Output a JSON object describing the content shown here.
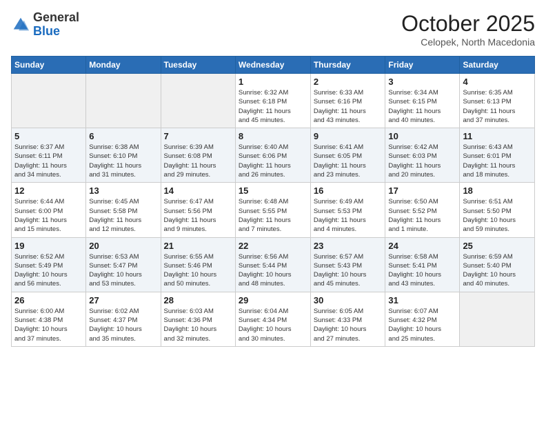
{
  "header": {
    "logo_general": "General",
    "logo_blue": "Blue",
    "month": "October 2025",
    "location": "Celopek, North Macedonia"
  },
  "weekdays": [
    "Sunday",
    "Monday",
    "Tuesday",
    "Wednesday",
    "Thursday",
    "Friday",
    "Saturday"
  ],
  "weeks": [
    [
      {
        "day": "",
        "info": ""
      },
      {
        "day": "",
        "info": ""
      },
      {
        "day": "",
        "info": ""
      },
      {
        "day": "1",
        "info": "Sunrise: 6:32 AM\nSunset: 6:18 PM\nDaylight: 11 hours\nand 45 minutes."
      },
      {
        "day": "2",
        "info": "Sunrise: 6:33 AM\nSunset: 6:16 PM\nDaylight: 11 hours\nand 43 minutes."
      },
      {
        "day": "3",
        "info": "Sunrise: 6:34 AM\nSunset: 6:15 PM\nDaylight: 11 hours\nand 40 minutes."
      },
      {
        "day": "4",
        "info": "Sunrise: 6:35 AM\nSunset: 6:13 PM\nDaylight: 11 hours\nand 37 minutes."
      }
    ],
    [
      {
        "day": "5",
        "info": "Sunrise: 6:37 AM\nSunset: 6:11 PM\nDaylight: 11 hours\nand 34 minutes."
      },
      {
        "day": "6",
        "info": "Sunrise: 6:38 AM\nSunset: 6:10 PM\nDaylight: 11 hours\nand 31 minutes."
      },
      {
        "day": "7",
        "info": "Sunrise: 6:39 AM\nSunset: 6:08 PM\nDaylight: 11 hours\nand 29 minutes."
      },
      {
        "day": "8",
        "info": "Sunrise: 6:40 AM\nSunset: 6:06 PM\nDaylight: 11 hours\nand 26 minutes."
      },
      {
        "day": "9",
        "info": "Sunrise: 6:41 AM\nSunset: 6:05 PM\nDaylight: 11 hours\nand 23 minutes."
      },
      {
        "day": "10",
        "info": "Sunrise: 6:42 AM\nSunset: 6:03 PM\nDaylight: 11 hours\nand 20 minutes."
      },
      {
        "day": "11",
        "info": "Sunrise: 6:43 AM\nSunset: 6:01 PM\nDaylight: 11 hours\nand 18 minutes."
      }
    ],
    [
      {
        "day": "12",
        "info": "Sunrise: 6:44 AM\nSunset: 6:00 PM\nDaylight: 11 hours\nand 15 minutes."
      },
      {
        "day": "13",
        "info": "Sunrise: 6:45 AM\nSunset: 5:58 PM\nDaylight: 11 hours\nand 12 minutes."
      },
      {
        "day": "14",
        "info": "Sunrise: 6:47 AM\nSunset: 5:56 PM\nDaylight: 11 hours\nand 9 minutes."
      },
      {
        "day": "15",
        "info": "Sunrise: 6:48 AM\nSunset: 5:55 PM\nDaylight: 11 hours\nand 7 minutes."
      },
      {
        "day": "16",
        "info": "Sunrise: 6:49 AM\nSunset: 5:53 PM\nDaylight: 11 hours\nand 4 minutes."
      },
      {
        "day": "17",
        "info": "Sunrise: 6:50 AM\nSunset: 5:52 PM\nDaylight: 11 hours\nand 1 minute."
      },
      {
        "day": "18",
        "info": "Sunrise: 6:51 AM\nSunset: 5:50 PM\nDaylight: 10 hours\nand 59 minutes."
      }
    ],
    [
      {
        "day": "19",
        "info": "Sunrise: 6:52 AM\nSunset: 5:49 PM\nDaylight: 10 hours\nand 56 minutes."
      },
      {
        "day": "20",
        "info": "Sunrise: 6:53 AM\nSunset: 5:47 PM\nDaylight: 10 hours\nand 53 minutes."
      },
      {
        "day": "21",
        "info": "Sunrise: 6:55 AM\nSunset: 5:46 PM\nDaylight: 10 hours\nand 50 minutes."
      },
      {
        "day": "22",
        "info": "Sunrise: 6:56 AM\nSunset: 5:44 PM\nDaylight: 10 hours\nand 48 minutes."
      },
      {
        "day": "23",
        "info": "Sunrise: 6:57 AM\nSunset: 5:43 PM\nDaylight: 10 hours\nand 45 minutes."
      },
      {
        "day": "24",
        "info": "Sunrise: 6:58 AM\nSunset: 5:41 PM\nDaylight: 10 hours\nand 43 minutes."
      },
      {
        "day": "25",
        "info": "Sunrise: 6:59 AM\nSunset: 5:40 PM\nDaylight: 10 hours\nand 40 minutes."
      }
    ],
    [
      {
        "day": "26",
        "info": "Sunrise: 6:00 AM\nSunset: 4:38 PM\nDaylight: 10 hours\nand 37 minutes."
      },
      {
        "day": "27",
        "info": "Sunrise: 6:02 AM\nSunset: 4:37 PM\nDaylight: 10 hours\nand 35 minutes."
      },
      {
        "day": "28",
        "info": "Sunrise: 6:03 AM\nSunset: 4:36 PM\nDaylight: 10 hours\nand 32 minutes."
      },
      {
        "day": "29",
        "info": "Sunrise: 6:04 AM\nSunset: 4:34 PM\nDaylight: 10 hours\nand 30 minutes."
      },
      {
        "day": "30",
        "info": "Sunrise: 6:05 AM\nSunset: 4:33 PM\nDaylight: 10 hours\nand 27 minutes."
      },
      {
        "day": "31",
        "info": "Sunrise: 6:07 AM\nSunset: 4:32 PM\nDaylight: 10 hours\nand 25 minutes."
      },
      {
        "day": "",
        "info": ""
      }
    ]
  ]
}
